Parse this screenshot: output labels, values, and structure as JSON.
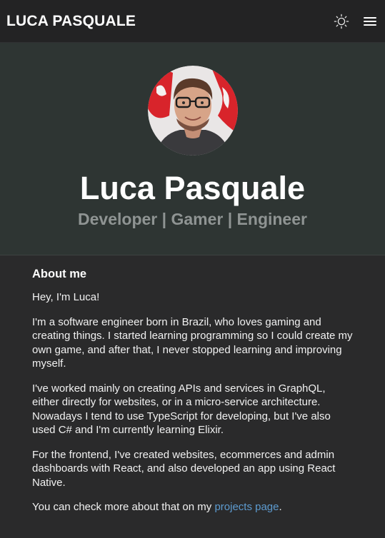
{
  "header": {
    "brand": "LUCA PASQUALE",
    "theme_toggle_icon": "sun-icon",
    "menu_icon": "hamburger-menu-icon"
  },
  "hero": {
    "avatar_icon": "avatar-photo",
    "name": "Luca Pasquale",
    "tagline": "Developer | Gamer | Engineer"
  },
  "about": {
    "title": "About me",
    "greeting": "Hey, I'm Luca!",
    "paragraph_1": "I'm a software engineer born in Brazil, who loves gaming and creating things. I started learning programming so I could create my own game, and after that, I never stopped learning and improving myself.",
    "paragraph_2": "I've worked mainly on creating APIs and services in GraphQL, either directly for websites, or in a micro-service architecture. Nowadays I tend to use TypeScript for developing, but I've also used C# and I'm currently learning Elixir.",
    "paragraph_3": "For the frontend, I've created websites, ecommerces and admin dashboards with React, and also developed an app using React Native.",
    "closing_prefix": "You can check more about that on my ",
    "projects_link": "projects page",
    "closing_suffix": "."
  },
  "colors": {
    "background": "#2a2a2b",
    "header": "#232324",
    "hero": "#2e3533",
    "tagline": "#8f9493",
    "link": "#5d9bd0"
  }
}
